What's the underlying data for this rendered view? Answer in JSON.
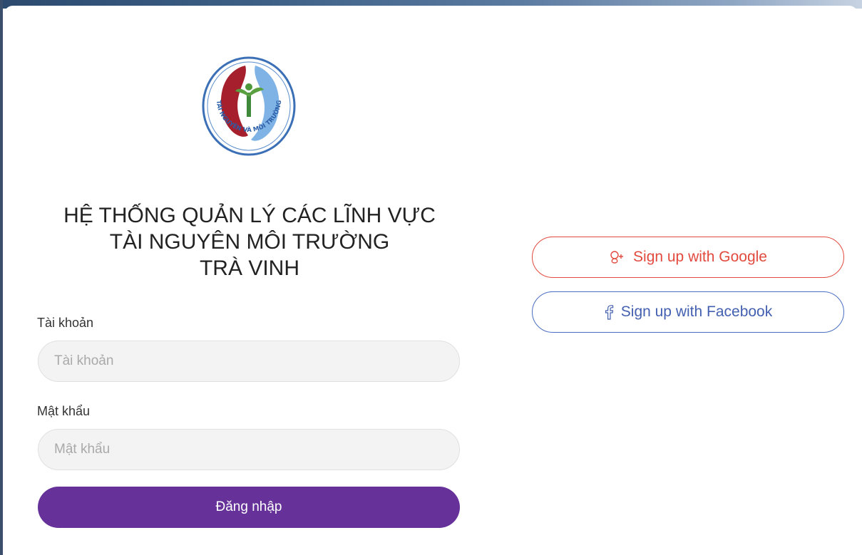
{
  "logo": {
    "name": "environment-agency-logo",
    "ring_text": "TÀI NGUYÊN VÀ MÔI TRƯỜNG"
  },
  "title": {
    "line1": "HỆ THỐNG QUẢN LÝ CÁC LĨNH VỰC",
    "line2": "TÀI NGUYÊN MÔI TRƯỜNG",
    "line3": "TRÀ VINH"
  },
  "form": {
    "username": {
      "label": "Tài khoản",
      "placeholder": "Tài khoản",
      "value": ""
    },
    "password": {
      "label": "Mật khẩu",
      "placeholder": "Mật khẩu",
      "value": ""
    },
    "submit_label": "Đăng nhập"
  },
  "social": {
    "google": {
      "label": "Sign up with Google",
      "icon": "google-plus-icon",
      "color": "#e24a3e"
    },
    "facebook": {
      "label": "Sign up with Facebook",
      "icon": "facebook-icon",
      "color": "#4460b0"
    }
  },
  "colors": {
    "primary": "#66329a",
    "input_background": "#f3f3f3"
  }
}
